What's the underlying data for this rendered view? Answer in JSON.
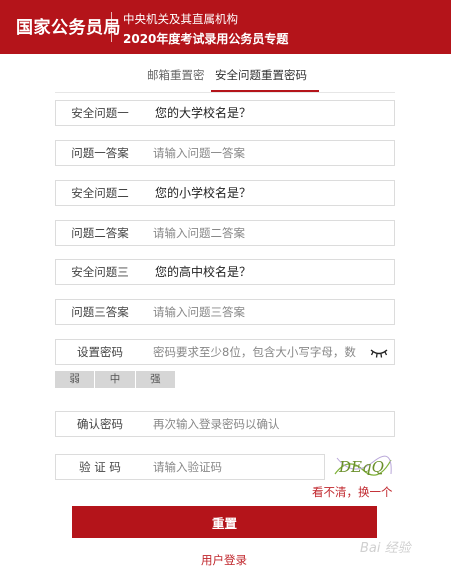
{
  "header": {
    "brand": "国家公务员局",
    "subtitle_line1": "中央机关及其直属机构",
    "subtitle_line2": "2020年度考试录用公务员专题"
  },
  "tabs": [
    {
      "label": "邮箱重置密",
      "active": false
    },
    {
      "label": "安全问题重置密码",
      "active": true
    }
  ],
  "form": {
    "question1": {
      "label": "安全问题一",
      "value": "您的大学校名是？"
    },
    "answer1": {
      "label": "问题一答案",
      "placeholder": "请输入问题一答案"
    },
    "question2": {
      "label": "安全问题二",
      "value": "您的小学校名是？"
    },
    "answer2": {
      "label": "问题二答案",
      "placeholder": "请输入问题二答案"
    },
    "question3": {
      "label": "安全问题三",
      "value": "您的高中校名是？"
    },
    "answer3": {
      "label": "问题三答案",
      "placeholder": "请输入问题三答案"
    },
    "password": {
      "label": "设置密码",
      "placeholder": "密码要求至少8位，包含大小写字母，数"
    },
    "strength": [
      "弱",
      "中",
      "强"
    ],
    "confirm": {
      "label": "确认密码",
      "placeholder": "再次输入登录密码以确认"
    },
    "captcha": {
      "label": "验 证 码",
      "placeholder": "请输入验证码",
      "image_text": "DEqQ"
    },
    "refresh_label": "看不清，换一个",
    "submit_label": "重置",
    "login_label": "用户登录"
  },
  "watermark": "Bai 经验",
  "colors": {
    "brand_red": "#b4141a",
    "link_red": "#c0272d"
  },
  "icons": {
    "password_toggle": "eye-closed-icon"
  }
}
